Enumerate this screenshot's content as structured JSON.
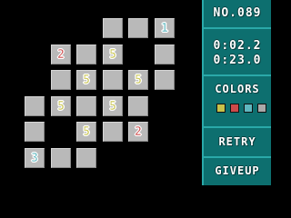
{
  "panel": {
    "puzzle_number": "NO.089",
    "time_elapsed": "0:02.2",
    "time_limit": "0:23.0",
    "colors_label": "COLORS",
    "retry_label": "RETRY",
    "giveup_label": "GIVEUP",
    "colors": [
      "#c7c24a",
      "#cc4a4a",
      "#5fb8c0",
      "#a9a9a9"
    ]
  },
  "board": {
    "tiles": [
      {
        "row": 0,
        "col": 4,
        "label": ""
      },
      {
        "row": 0,
        "col": 5,
        "label": ""
      },
      {
        "row": 0,
        "col": 6,
        "label": "1",
        "color": "#5fb8c0"
      },
      {
        "row": 1,
        "col": 2,
        "label": "2",
        "color": "#cc4a4a"
      },
      {
        "row": 1,
        "col": 3,
        "label": ""
      },
      {
        "row": 1,
        "col": 4,
        "label": "5",
        "color": "#c7c24a"
      },
      {
        "row": 1,
        "col": 6,
        "label": ""
      },
      {
        "row": 2,
        "col": 2,
        "label": ""
      },
      {
        "row": 2,
        "col": 3,
        "label": "5",
        "color": "#c7c24a"
      },
      {
        "row": 2,
        "col": 4,
        "label": ""
      },
      {
        "row": 2,
        "col": 5,
        "label": "5",
        "color": "#c7c24a"
      },
      {
        "row": 2,
        "col": 6,
        "label": ""
      },
      {
        "row": 3,
        "col": 1,
        "label": ""
      },
      {
        "row": 3,
        "col": 2,
        "label": "5",
        "color": "#c7c24a"
      },
      {
        "row": 3,
        "col": 3,
        "label": ""
      },
      {
        "row": 3,
        "col": 4,
        "label": "5",
        "color": "#c7c24a"
      },
      {
        "row": 3,
        "col": 5,
        "label": ""
      },
      {
        "row": 4,
        "col": 1,
        "label": ""
      },
      {
        "row": 4,
        "col": 3,
        "label": "5",
        "color": "#c7c24a"
      },
      {
        "row": 4,
        "col": 4,
        "label": ""
      },
      {
        "row": 4,
        "col": 5,
        "label": "2",
        "color": "#cc4a4a"
      },
      {
        "row": 5,
        "col": 1,
        "label": "3",
        "color": "#5fb8c0"
      },
      {
        "row": 5,
        "col": 2,
        "label": ""
      },
      {
        "row": 5,
        "col": 3,
        "label": ""
      }
    ]
  }
}
